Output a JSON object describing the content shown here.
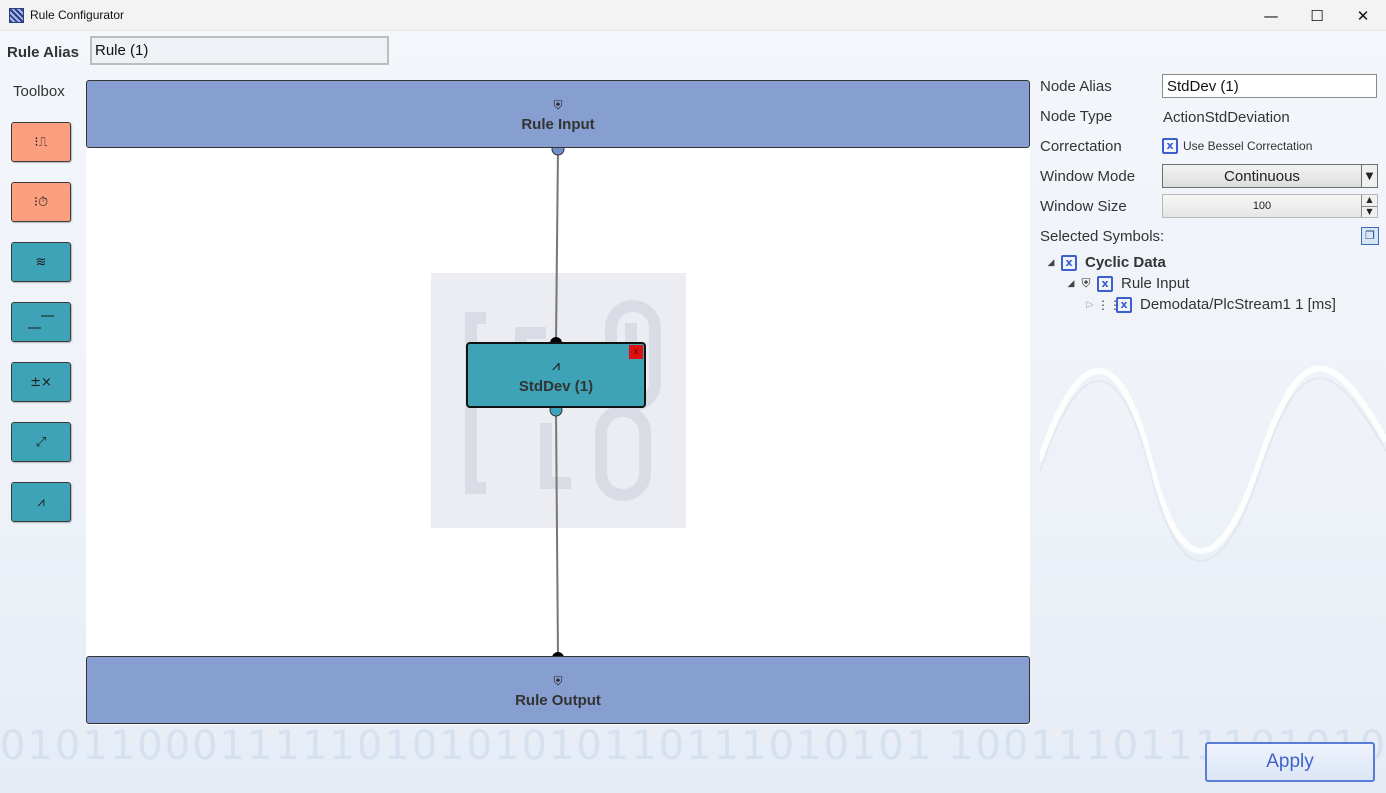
{
  "window": {
    "title": "Rule Configurator",
    "minimize": "—",
    "maximize": "☐",
    "close": "✕"
  },
  "rule_alias": {
    "label": "Rule Alias",
    "value": "Rule (1)"
  },
  "toolbox": {
    "label": "Toolbox",
    "tools": [
      {
        "icon": "trigger-icon",
        "glyph": "⁝⎍",
        "color": "#fb9f7f"
      },
      {
        "icon": "timer-trigger-icon",
        "glyph": "⁝⏱",
        "color": "#fb9f7f"
      },
      {
        "icon": "filter-icon",
        "glyph": "≋",
        "color": "#3fa3b7"
      },
      {
        "icon": "threshold-icon",
        "glyph": "⎽⎺",
        "color": "#3fa3b7"
      },
      {
        "icon": "multiply-icon",
        "glyph": "±×",
        "color": "#3fa3b7"
      },
      {
        "icon": "scale-icon",
        "glyph": "⤢",
        "color": "#3fa3b7"
      },
      {
        "icon": "std-deviation-icon",
        "glyph": "⩘",
        "color": "#3fa3b7"
      }
    ]
  },
  "canvas": {
    "input_bar": {
      "icon": "stream-icon",
      "glyph": "⛨",
      "label": "Rule Input"
    },
    "output_bar": {
      "icon": "stream-icon",
      "glyph": "⛨",
      "label": "Rule Output"
    },
    "action_node": {
      "icon": "std-deviation-icon",
      "glyph": "⩘",
      "label": "StdDev (1)",
      "close": "x"
    }
  },
  "properties": {
    "node_alias": {
      "label": "Node Alias",
      "value": "StdDev (1)"
    },
    "node_type": {
      "label": "Node Type",
      "value": "ActionStdDeviation"
    },
    "correctation": {
      "label": "Correctation",
      "checkbox_label": "Use Bessel Correctation",
      "checked": true,
      "check": "x"
    },
    "window_mode": {
      "label": "Window Mode",
      "value": "Continuous",
      "arrow": "▼"
    },
    "window_size": {
      "label": "Window Size",
      "value": "100",
      "up": "▲",
      "down": "▼"
    },
    "selected_symbols": {
      "label": "Selected Symbols:",
      "button_glyph": "❐"
    }
  },
  "tree": {
    "open_arrow": "◢",
    "closed_arrow": "▷",
    "nodes": [
      {
        "label": "Cyclic Data",
        "check": "x",
        "bold": true
      },
      {
        "label": "Rule Input",
        "check": "x",
        "glyph": "⛨"
      },
      {
        "label": "Demodata/PlcStream1 1 [ms]",
        "check": "x",
        "glyph": "⋮⋮"
      }
    ]
  },
  "background": {
    "binary_text": "0101100011111010101010110111010101 10011101111010101"
  },
  "apply": {
    "label": "Apply"
  },
  "colors": {
    "accent": "#3c5fcf",
    "stream_bar": "#879ed1",
    "action_teal": "#3fa3b7",
    "trigger_orange": "#fb9f7f",
    "close_red": "#e01010"
  }
}
